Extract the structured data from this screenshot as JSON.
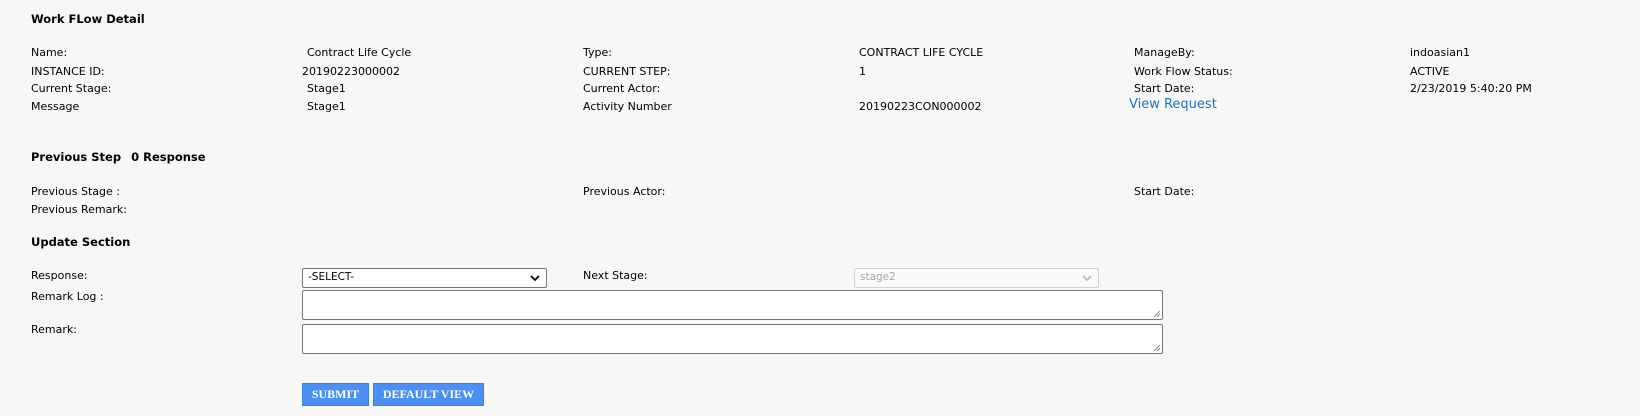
{
  "workflow": {
    "heading": "Work FLow Detail",
    "name_label": "Name:",
    "name_value": "Contract Life Cycle",
    "type_label": "Type:",
    "type_value": "CONTRACT LIFE CYCLE",
    "manageby_label": "ManageBy:",
    "manageby_value": "indoasian1",
    "instance_label": "INSTANCE ID:",
    "instance_value": "20190223000002",
    "current_step_label": "CURRENT STEP:",
    "current_step_value": "1",
    "status_label": "Work Flow Status:",
    "status_value": "ACTIVE",
    "current_stage_label": "Current Stage:",
    "current_stage_value": "Stage1",
    "current_actor_label": "Current Actor:",
    "start_date_label": "Start Date:",
    "start_date_value": "2/23/2019 5:40:20 PM",
    "message_label": "Message",
    "message_value": "Stage1",
    "activity_label": "Activity Number",
    "activity_value": "20190223CON000002",
    "view_request_link": "View Request"
  },
  "previous": {
    "heading": "Previous Step",
    "response_count": "0 Response",
    "stage_label": "Previous Stage :",
    "actor_label": "Previous Actor:",
    "start_date_label": "Start Date:",
    "remark_label": "Previous Remark:"
  },
  "update": {
    "heading": "Update Section",
    "response_label": "Response:",
    "response_selected": "-SELECT-",
    "next_stage_label": "Next Stage:",
    "next_stage_selected": "stage2",
    "remark_log_label": "Remark Log :",
    "remark_label": "Remark:",
    "submit_label": "SUBMIT",
    "default_view_label": "DEFAULT VIEW"
  },
  "colors": {
    "button": "#4d90f5",
    "link": "#1a73c8",
    "background": "#f7f7f7"
  }
}
